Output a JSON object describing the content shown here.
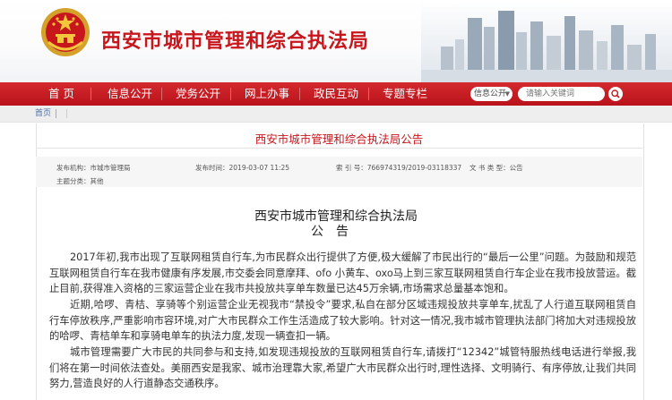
{
  "header": {
    "site_title": "西安市城市管理和综合执法局",
    "brand_color": "#c8161d",
    "emblem_icon": "national-emblem-icon"
  },
  "nav": {
    "items": [
      "首 页",
      "信息公开",
      "党务公开",
      "网上办事",
      "政民互动",
      "专题专栏"
    ],
    "search_scope": "信息公开",
    "search_placeholder": "请输入关键词",
    "search_icon": "search-icon",
    "nav_color": "#c3171f"
  },
  "breadcrumb": {
    "home": "首页"
  },
  "article": {
    "title": "西安市城市管理和综合执法局公告",
    "meta": {
      "publisher": "发布机构：市城市管理局",
      "publish_time": "发布时间：2019-03-07 11:25",
      "index_no": "索 引 号：766974319/2019-03118337",
      "category": "主题分类：其他",
      "doc_type": "文 书 类 型：公告"
    },
    "heading_org": "西安市城市管理和综合执法局",
    "heading_notice": "公告",
    "paragraphs": [
      "2017年初,我市出现了互联网租赁自行车,为市民群众出行提供了方便,极大缓解了市民出行的“最后一公里”问题。为鼓励和规范互联网租赁自行车在我市健康有序发展,市交委会同意摩拜、ofo 小黄车、oxo马上到三家互联网租赁自行车企业在我市投放营运。截止目前,获得准入资格的三家运营企业在我市共投放共享单车数量已达45万余辆,市场需求总量基本饱和。",
      "近期,哈啰、青桔、享骑等个别运营企业无视我市“禁投令”要求,私自在部分区域违规投放共享单车,扰乱了人行道互联网租赁自行车停放秩序,严重影响市容环境,对广大市民群众工作生活造成了较大影响。针对这一情况,我市城市管理执法部门将加大对违规投放的哈啰、青桔单车和享骑电单车的执法力度,发现一辆查扣一辆。",
      "城市管理需要广大市民的共同参与和支持,如发现违规投放的互联网租赁自行车,请拨打“12342”城管特服热线电话进行举报,我们将在第一时间依法查处。美丽西安是我家、城市治理靠大家,希望广大市民群众出行时,理性选择、文明骑行、有序停放,让我们共同努力,营造良好的人行道静态交通秩序。"
    ]
  }
}
